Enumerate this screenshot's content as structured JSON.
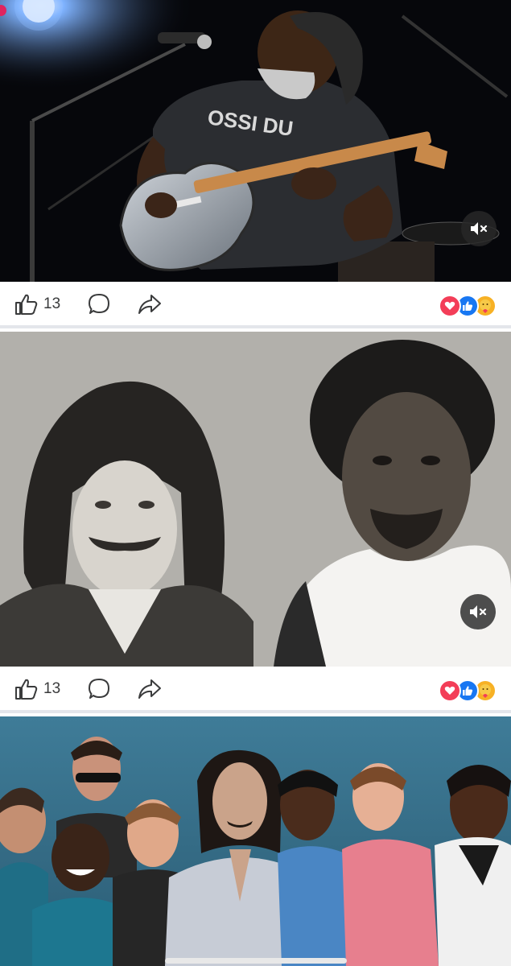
{
  "posts": [
    {
      "image": "guitarist-on-stage-photo",
      "like_count": "13",
      "reactions": [
        "love",
        "like",
        "care"
      ],
      "muted": true
    },
    {
      "image": "black-and-white-duo-portrait",
      "like_count": "13",
      "reactions": [
        "love",
        "like",
        "care"
      ],
      "muted": true
    },
    {
      "image": "band-group-photo"
    }
  ],
  "icons": {
    "like": "thumbs-up-icon",
    "comment": "comment-bubble-icon",
    "share": "share-arrow-icon",
    "mute": "speaker-muted-icon"
  },
  "colors": {
    "love": "#f33e58",
    "like": "#1877f2",
    "care": "#f7b125",
    "text": "#3a3b3c",
    "divider": "#e4e6eb"
  }
}
